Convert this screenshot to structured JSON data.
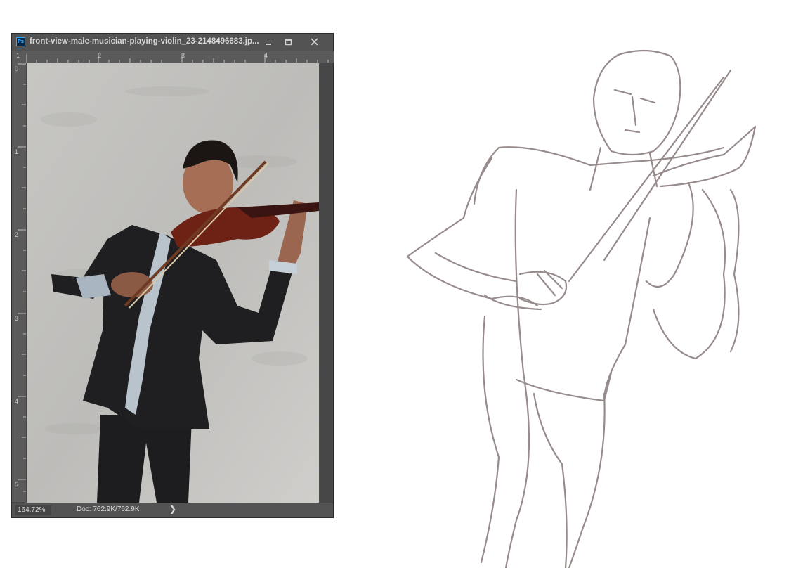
{
  "window": {
    "app_icon": "photoshop-app-icon",
    "app_icon_text": "Ps",
    "title": "front-view-male-musician-playing-violin_23-2148496683.jp...",
    "buttons": [
      "minimize-icon",
      "maximize-icon",
      "close-icon"
    ]
  },
  "ruler": {
    "top_labels": [
      "1",
      "2",
      "3",
      "4"
    ],
    "left_labels": [
      "0",
      "1",
      "2",
      "3",
      "4",
      "5"
    ]
  },
  "status": {
    "zoom": "164.72%",
    "doc": "Doc: 762.9K/762.9K",
    "arrow": "❯"
  },
  "colors": {
    "panel": "#535353",
    "canvas_bg": "#4a4a4a",
    "sketch_stroke": "#8c7f7f"
  }
}
